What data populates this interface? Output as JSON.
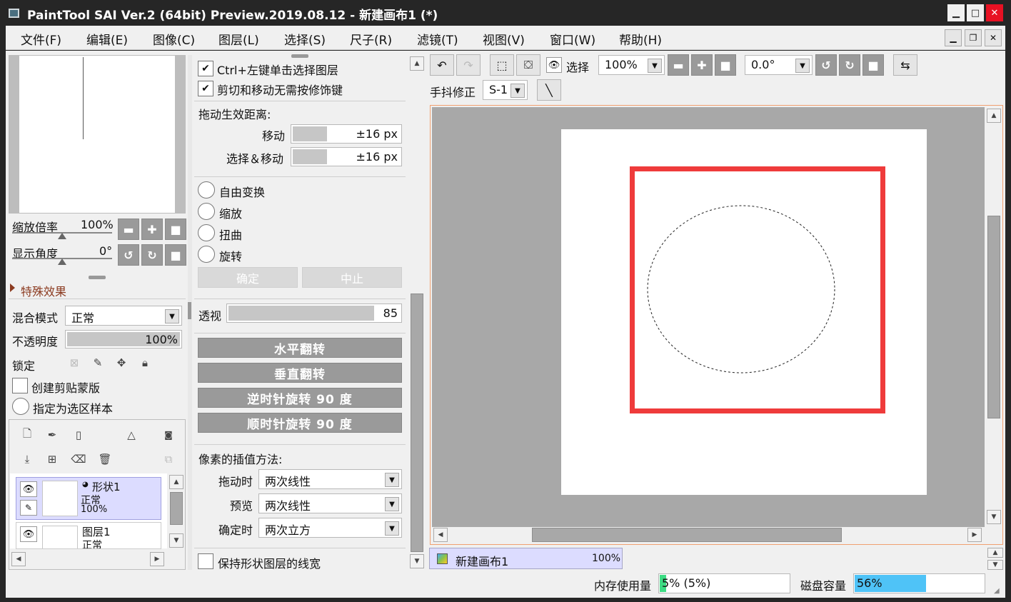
{
  "window": {
    "title": "PaintTool SAI Ver.2 (64bit) Preview.2019.08.12 - 新建画布1 (*)"
  },
  "menu": [
    "文件(F)",
    "编辑(E)",
    "图像(C)",
    "图层(L)",
    "选择(S)",
    "尺子(R)",
    "滤镜(T)",
    "视图(V)",
    "窗口(W)",
    "帮助(H)"
  ],
  "navigator": {
    "zoom_label": "缩放倍率",
    "zoom_value": "100%",
    "angle_label": "显示角度",
    "angle_value": "0°"
  },
  "layer_props": {
    "effects_label": "特殊效果",
    "blend_label": "混合模式",
    "blend_value": "正常",
    "opacity_label": "不透明度",
    "opacity_value": "100%",
    "opacity_fraction": 1.0,
    "lock_label": "锁定",
    "clip_label": "创建剪贴蒙版",
    "sample_label": "指定为选区样本"
  },
  "layers": [
    {
      "name": "形状1",
      "mode": "正常",
      "opacity": "100%"
    },
    {
      "name": "图层1",
      "mode": "正常"
    }
  ],
  "transform": {
    "ctrl_click_label": "Ctrl+左键单击选择图层",
    "cut_move_label": "剪切和移动无需按修饰键",
    "drag_distance_label": "拖动生效距离:",
    "move_label": "移动",
    "move_value": "±16 px",
    "select_move_label": "选择＆移动",
    "select_move_value": "±16 px",
    "free_transform": "自由变换",
    "scale": "缩放",
    "distort": "扭曲",
    "rotate": "旋转",
    "ok": "确定",
    "cancel": "中止",
    "perspective_label": "透视",
    "perspective_value": "85",
    "perspective_fraction": 0.85,
    "flip_h": "水平翻转",
    "flip_v": "垂直翻转",
    "rotate_ccw": "逆时针旋转 90 度",
    "rotate_cw": "顺时针旋转 90 度",
    "interp_label": "像素的插值方法:",
    "drag_time_label": "拖动时",
    "drag_time_value": "两次线性",
    "preview_label": "预览",
    "preview_value": "两次线性",
    "confirm_label": "确定时",
    "confirm_value": "两次立方",
    "keep_width_label": "保持形状图层的线宽"
  },
  "toolbar": {
    "select_label": "选择",
    "zoom_value": "100%",
    "angle_value": "0.0°",
    "stabilizer_label": "手抖修正",
    "stabilizer_value": "S-1"
  },
  "document_tab": {
    "name": "新建画布1",
    "zoom": "100%"
  },
  "status": {
    "memory_label": "内存使用量",
    "memory_value": "5% (5%)",
    "memory_fraction": 0.05,
    "disk_label": "磁盘容量",
    "disk_value": "56%",
    "disk_fraction": 0.56
  },
  "colors": {
    "accent_blue": "#4fc3f7",
    "selection_red": "#ef3b3b",
    "memory_green": "#3ddc84",
    "layer_selected": "#dcdcff"
  }
}
